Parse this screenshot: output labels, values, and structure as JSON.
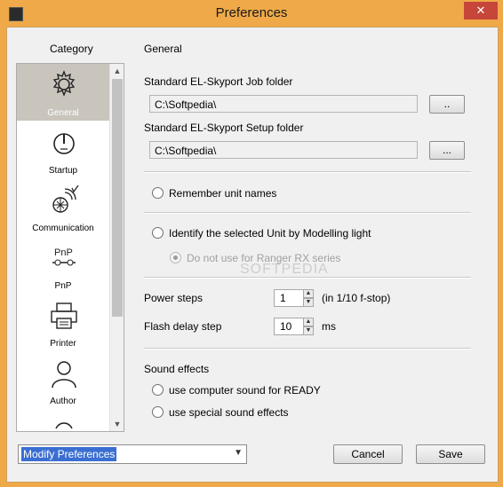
{
  "window": {
    "title": "Preferences",
    "close_glyph": "✕"
  },
  "category": {
    "title": "Category",
    "items": [
      {
        "label": "General",
        "icon": "gear-icon"
      },
      {
        "label": "Startup",
        "icon": "power-icon"
      },
      {
        "label": "Communication",
        "icon": "network-icon"
      },
      {
        "label": "PnP",
        "icon": "pnp-icon"
      },
      {
        "label": "Printer",
        "icon": "printer-icon"
      },
      {
        "label": "Author",
        "icon": "person-icon"
      }
    ]
  },
  "general": {
    "title": "General",
    "job_folder_label": "Standard EL-Skyport Job folder",
    "job_folder_value": "C:\\Softpedia\\",
    "browse_label": "..",
    "setup_folder_label": "Standard EL-Skyport Setup folder",
    "setup_folder_value": "C:\\Softpedia\\",
    "browse_label_2": "...",
    "remember_unit_names": "Remember unit names",
    "identify_unit": "Identify the selected Unit by Modelling light",
    "ranger_option": "Do not use for Ranger RX series",
    "power_steps_label": "Power steps",
    "power_steps_value": "1",
    "power_steps_unit": "(in 1/10 f-stop)",
    "flash_delay_label": "Flash delay step",
    "flash_delay_value": "10",
    "flash_delay_unit": "ms",
    "sound_effects_title": "Sound effects",
    "sound_ready": "use computer sound for READY",
    "sound_special": "use special sound effects"
  },
  "footer": {
    "combo_value": "Modify Preferences",
    "cancel_label": "Cancel",
    "save_label": "Save"
  },
  "watermark": "SOFTPEDIA"
}
